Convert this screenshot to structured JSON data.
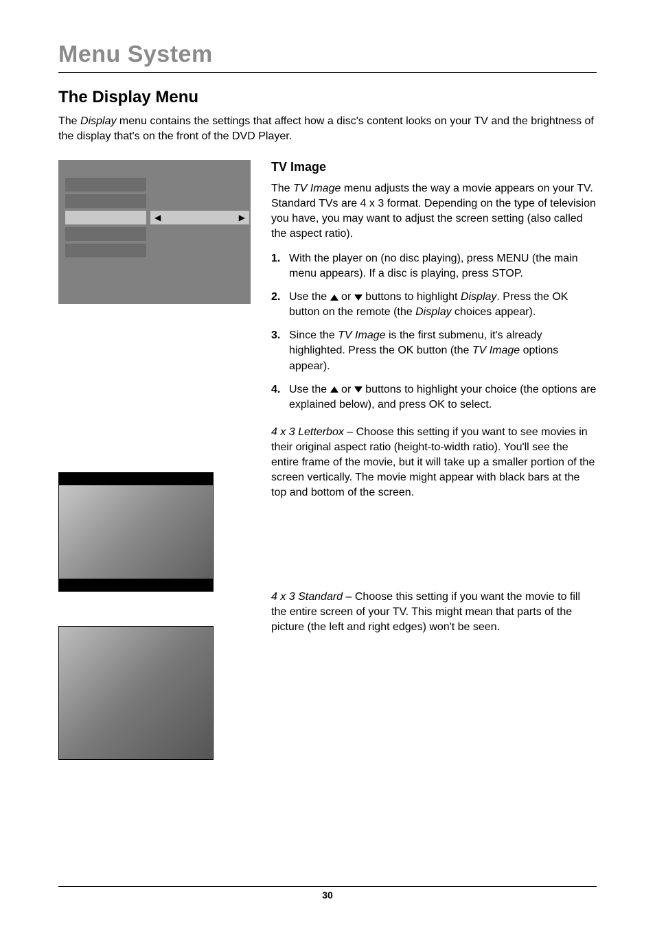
{
  "chapter": "Menu System",
  "section": "The Display Menu",
  "intro": "The Display menu contains the settings that affect how a disc's content looks on your TV and the brightness of the display that's on the front of the DVD Player.",
  "tvimage": {
    "title": "TV Image",
    "para": "The TV Image menu adjusts the way a movie appears on your TV. Standard TVs are 4 x 3 format. Depending on the type of television you have, you may want to adjust the screen setting (also called the aspect ratio).",
    "steps": [
      "With the player on (no disc playing), press MENU (the main menu appears). If a disc is playing, press STOP.",
      "Use the ▲ or ▼ buttons to highlight Display. Press the OK button on the remote (the Display choices appear).",
      "Since the TV Image is the first submenu, it's already highlighted. Press the OK button (the TV Image options appear).",
      "Use the ▲ or ▼ buttons to highlight your choice (the options are explained below), and press OK to select."
    ]
  },
  "letterbox": "4 x 3 Letterbox – Choose this setting if you want to see movies in their original aspect ratio (height-to-width ratio). You'll see the entire frame of the movie, but it will take up a smaller portion of the screen vertically. The movie might appear with black bars at the top and bottom of the screen.",
  "standard": "4 x 3 Standard – Choose this setting if you want the movie to fill the entire screen of your TV. This might mean that parts of the picture (the left and right edges) won't be seen.",
  "pageNumber": "30"
}
